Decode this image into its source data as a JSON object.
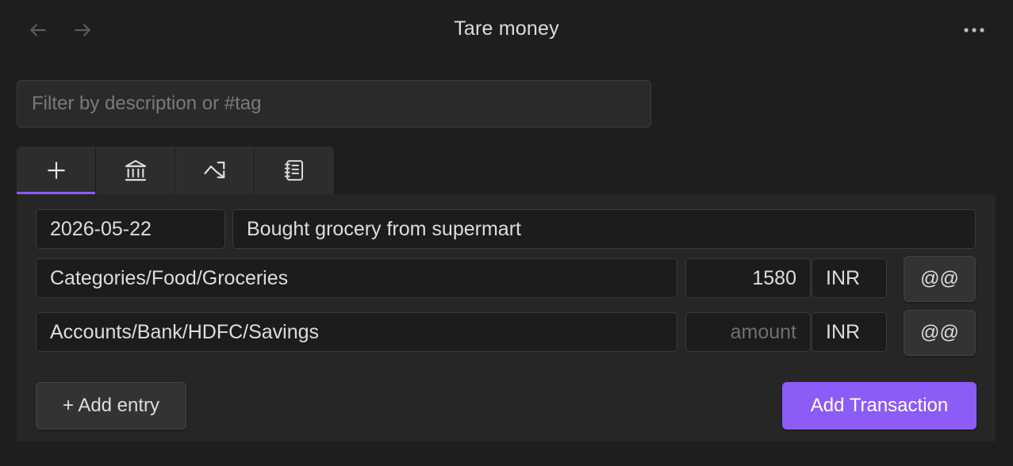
{
  "header": {
    "title": "Tare money",
    "back_icon": "arrow-left-icon",
    "forward_icon": "arrow-right-icon",
    "more_icon": "more-horizontal-icon"
  },
  "filter": {
    "placeholder": "Filter by description or #tag",
    "value": ""
  },
  "tabs": [
    {
      "icon": "plus-icon",
      "active": true
    },
    {
      "icon": "bank-icon",
      "active": false
    },
    {
      "icon": "trending-icon",
      "active": false
    },
    {
      "icon": "notebook-icon",
      "active": false
    }
  ],
  "transaction": {
    "date": "2026-05-22",
    "description": "Bought grocery from supermart",
    "entries": [
      {
        "account": "Categories/Food/Groceries",
        "amount": "1580",
        "amount_placeholder": "amount",
        "currency": "INR",
        "price_label": "@@"
      },
      {
        "account": "Accounts/Bank/HDFC/Savings",
        "amount": "",
        "amount_placeholder": "amount",
        "currency": "INR",
        "price_label": "@@"
      }
    ]
  },
  "actions": {
    "add_entry_label": "+ Add entry",
    "add_transaction_label": "Add Transaction"
  },
  "colors": {
    "background": "#1e1e1e",
    "panel": "#262626",
    "accent": "#8b5cf6"
  }
}
